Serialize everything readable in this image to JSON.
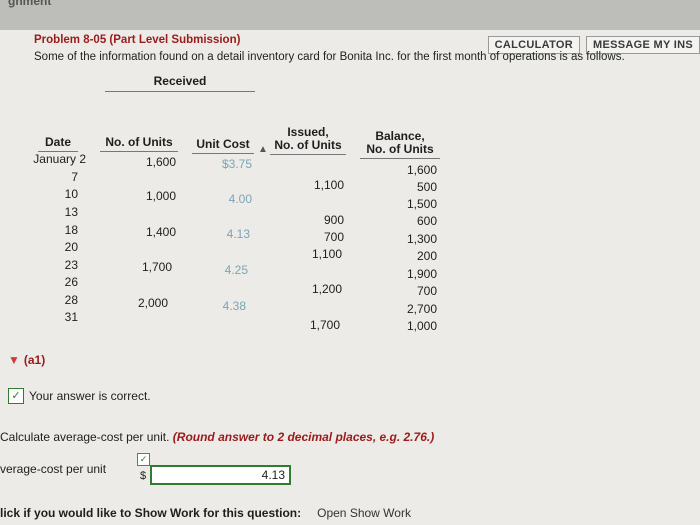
{
  "header": {
    "cut_title": "gnment",
    "calculator_button": "CALCULATOR",
    "message_button": "MESSAGE MY INS"
  },
  "problem": {
    "title": "Problem 8-05 (Part Level Submission)",
    "description": "Some of the information found on a detail inventory card for Bonita Inc. for the first month of operations is as follows."
  },
  "table": {
    "received_header": "Received",
    "headers": {
      "date": "Date",
      "units": "No. of Units",
      "cost": "Unit Cost",
      "issued": "Issued,\nNo. of Units",
      "balance": "Balance,\nNo. of Units"
    },
    "dates": [
      "January 2",
      "7",
      "10",
      "13",
      "18",
      "20",
      "23",
      "26",
      "28",
      "31"
    ],
    "received_units": [
      "1,600",
      "1,000",
      "1,400",
      "1,700",
      "2,000"
    ],
    "unit_costs": [
      "$3.75",
      "4.00",
      "4.13",
      "4.25",
      "4.38"
    ],
    "issued_units": [
      "1,100",
      "900",
      "700",
      "1,100",
      "1,200",
      "1,700"
    ],
    "balances": [
      "1,600",
      "500",
      "1,500",
      "600",
      "1,300",
      "200",
      "1,900",
      "700",
      "2,700",
      "1,000"
    ]
  },
  "answer_section": {
    "part_label": "(a1)",
    "correct_text": "Your answer is correct.",
    "instruction_main": "Calculate average-cost per unit.",
    "instruction_hint": "(Round answer to 2 decimal places, e.g. 2.76.)",
    "field_label": "verage-cost per unit",
    "currency": "$",
    "answer_value": "4.13"
  },
  "show_work": {
    "question": "lick if you would like to Show Work for this question:",
    "link_label": "Open Show Work"
  },
  "colors": {
    "accent_red": "#9a1b1b",
    "success_green": "#2f7d2f"
  }
}
